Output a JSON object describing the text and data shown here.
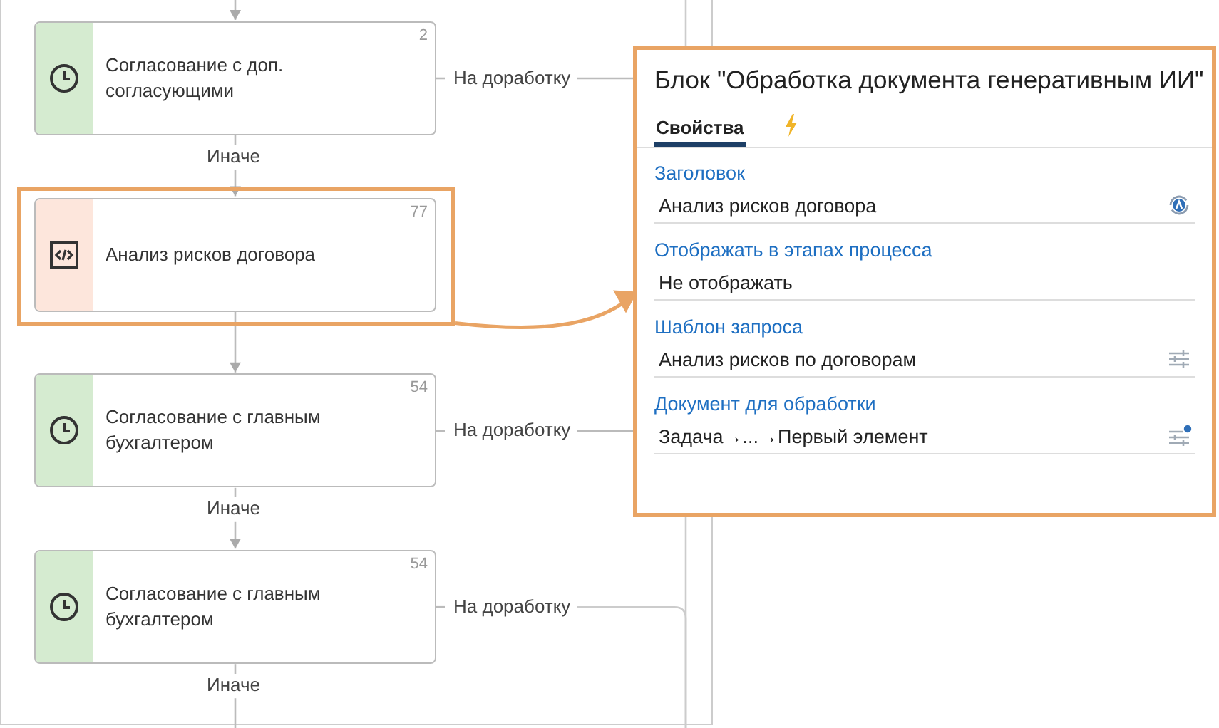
{
  "canvas": {
    "nodes": [
      {
        "kind": "timer",
        "title": "Согласование с доп. согласующими",
        "number": "2",
        "highlighted": false,
        "rework_label": "На доработку",
        "else_label": "Иначе"
      },
      {
        "kind": "script",
        "title": "Анализ рисков договора",
        "number": "77",
        "highlighted": true
      },
      {
        "kind": "timer",
        "title": "Согласование с главным бухгалтером",
        "number": "54",
        "highlighted": false,
        "rework_label": "На доработку",
        "else_label": "Иначе"
      },
      {
        "kind": "timer",
        "title": "Согласование с главным бухгалтером",
        "number": "54",
        "highlighted": false,
        "rework_label": "На доработку",
        "else_label": "Иначе"
      }
    ]
  },
  "panel": {
    "title": "Блок \"Обработка документа генеративным ИИ\"",
    "tabs": [
      {
        "kind": "text",
        "label": "Свойства",
        "selected": true
      },
      {
        "kind": "events",
        "selected": false
      }
    ],
    "fields": [
      {
        "label": "Заголовок",
        "value": "Анализ рисков договора",
        "kind": "auto"
      },
      {
        "label": "Отображать в этапах процесса",
        "value": "Не отображать",
        "kind": "plain"
      },
      {
        "label": "Шаблон запроса",
        "value": "Анализ рисков по договорам",
        "kind": "settings"
      },
      {
        "label": "Документ для обработки",
        "value": "Задача→...→Первый элемент",
        "kind": "settings-set"
      }
    ]
  }
}
